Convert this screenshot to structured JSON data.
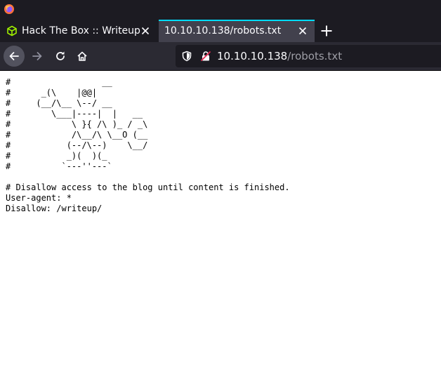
{
  "browser": {
    "tabs": [
      {
        "title": "Hack The Box :: Writeup",
        "active": false,
        "favicon": "htb-cube-icon"
      },
      {
        "title": "10.10.10.138/robots.txt",
        "active": true,
        "favicon": ""
      }
    ],
    "url": {
      "host": "10.10.10.138",
      "path": "/robots.txt"
    },
    "icons": {
      "title": "firefox-icon",
      "back": "arrow-left-icon",
      "forward": "arrow-right-icon",
      "reload": "reload-icon",
      "home": "home-icon",
      "new_tab": "plus-icon",
      "close": "close-icon",
      "shield": "shield-icon",
      "insecure": "insecure-lock-icon"
    },
    "colors": {
      "chrome_bg": "#1c1b22",
      "active_tab": "#42414d",
      "accent": "#00ddff",
      "htb_green": "#9fef00",
      "insecure_red": "#e22850"
    }
  },
  "page": {
    "content": "#                  __\n#      _(\\    |@@|\n#     (__/\\__ \\--/ __\n#        \\___|----|  |   __\n#            \\ }{ /\\ )_ / _\\\n#            /\\__/\\ \\__O (__\n#           (--/\\--)    \\__/\n#           _)(  )(_\n#          `---''---`\n\n# Disallow access to the blog until content is finished.\nUser-agent: *\nDisallow: /writeup/"
  }
}
